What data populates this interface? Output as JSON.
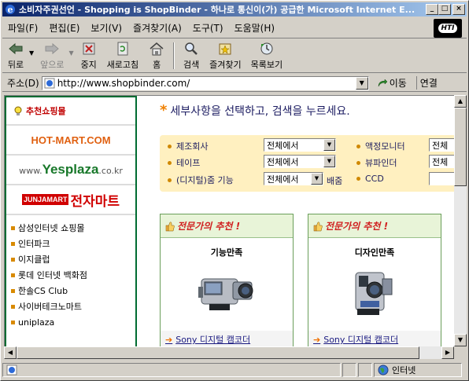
{
  "window": {
    "title": "소비자주권선언 - Shopping is ShopBinder - 하나로 통신이(가) 공급한 Microsoft Internet E...",
    "controls": {
      "minimize": "_",
      "maximize": "□",
      "close": "×"
    }
  },
  "menu": {
    "items": [
      "파일(F)",
      "편집(E)",
      "보기(V)",
      "즐겨찾기(A)",
      "도구(T)",
      "도움말(H)"
    ],
    "brand": "HTI"
  },
  "toolbar": {
    "back": "뒤로",
    "forward": "앞으로",
    "stop": "중지",
    "refresh": "새로고침",
    "home": "홈",
    "search": "검색",
    "favorites": "즐겨찾기",
    "history": "목록보기"
  },
  "address": {
    "label": "주소(D)",
    "url": "http://www.shopbinder.com/",
    "go": "이동",
    "links": "연결"
  },
  "sidebar": {
    "heading": "추천쇼핑몰",
    "logos": {
      "hotmart": "HOT-MART.COM",
      "yesplaza_prefix": "www.",
      "yesplaza_main": "Yesplaza",
      "yesplaza_suffix": ".co.kr",
      "junjamart_en": "JUNJAMART",
      "junjamart_ko": "전자마트"
    },
    "shops": [
      "삼성인터넷 쇼핑몰",
      "인터파크",
      "이지클럽",
      "롯데 인터넷 백화점",
      "한솔CS Club",
      "사이버테크노마트",
      "uniplaza"
    ]
  },
  "main": {
    "instruction": "세부사항을 선택하고, 검색을 누르세요.",
    "filters": {
      "maker_label": "제조회사",
      "maker_value": "전체에서",
      "tape_label": "테이프",
      "tape_value": "전체에서",
      "zoom_label": "(디지털)줌 기능",
      "zoom_value": "전체에서",
      "zoom_suffix": "배줌",
      "lcd_label": "액정모니터",
      "lcd_value": "전체",
      "viewfinder_label": "뷰파인더",
      "viewfinder_value": "전체",
      "ccd_label": "CCD",
      "ccd_value": ""
    },
    "cards": [
      {
        "heading": "전문가의 추천 !",
        "title": "기능만족",
        "link": "Sony 디지털 캠코더"
      },
      {
        "heading": "전문가의 추천 !",
        "title": "디자인만족",
        "link": "Sony 디지털 캠코더"
      }
    ]
  },
  "status": {
    "zone": "인터넷"
  }
}
